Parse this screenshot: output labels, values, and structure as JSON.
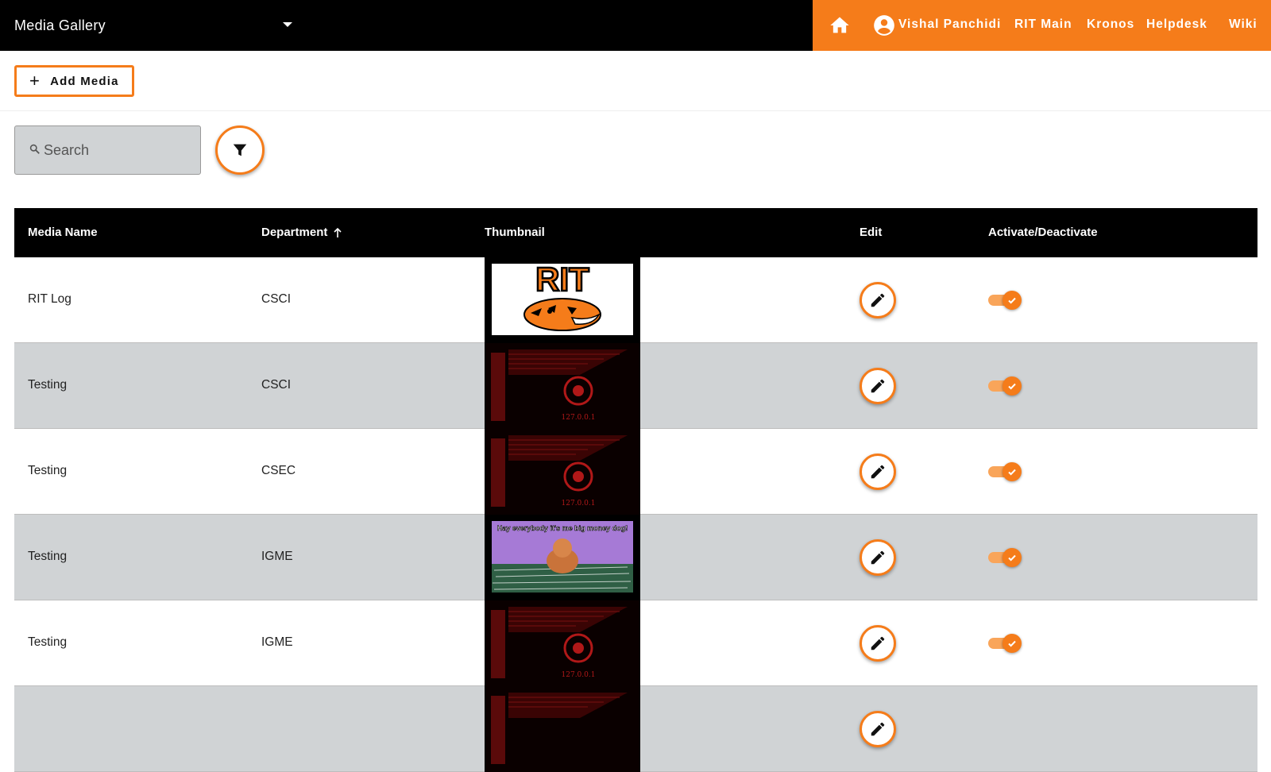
{
  "header": {
    "app_select": "Media Gallery",
    "user_name": "Vishal Panchidi",
    "nav": [
      "RIT Main",
      "Kronos",
      "Helpdesk",
      "Wiki"
    ],
    "icons": {
      "home": "home-icon",
      "user": "account-circle-icon",
      "dropdown": "chevron-down-icon"
    },
    "accent": "#f57c1a"
  },
  "toolbar": {
    "add_label": "Add Media",
    "search_placeholder": "Search"
  },
  "table": {
    "columns": [
      "Media Name",
      "Department",
      "Thumbnail",
      "Edit",
      "Activate/Deactivate"
    ],
    "sort": {
      "column": "Department",
      "direction": "ascending"
    },
    "rows": [
      {
        "name": "RIT Log",
        "department": "CSCI",
        "thumbnail": "rit-tiger-logo",
        "active": true
      },
      {
        "name": "Testing",
        "department": "CSCI",
        "thumbnail": "red-black-poster",
        "active": true
      },
      {
        "name": "Testing",
        "department": "CSEC",
        "thumbnail": "red-black-poster",
        "active": true
      },
      {
        "name": "Testing",
        "department": "IGME",
        "thumbnail": "money-dog-meme",
        "active": true
      },
      {
        "name": "Testing",
        "department": "IGME",
        "thumbnail": "red-black-poster",
        "active": true
      },
      {
        "name": "",
        "department": "",
        "thumbnail": "red-black-poster",
        "active": true
      }
    ]
  },
  "thumbnail_text": {
    "rit_logo": "RIT",
    "poster_ip": "127.0.0.1",
    "poster_side": "arasaka",
    "poster_jp": "アラサカ社",
    "meme_top": "Hay everybody it's me big money dog!"
  }
}
